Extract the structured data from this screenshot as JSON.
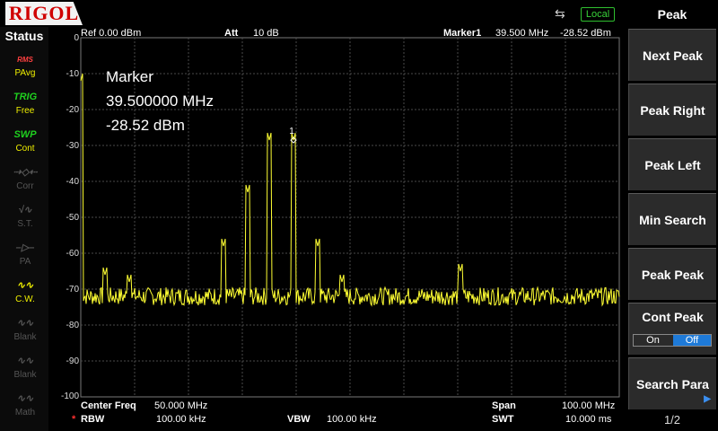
{
  "brand": "RIGOL",
  "topbar": {
    "local": "Local",
    "usb_icon": "usb-icon"
  },
  "status": {
    "title": "Status",
    "items": [
      {
        "top": "RMS",
        "label": "PAvg",
        "icon": "pavg-icon"
      },
      {
        "top": "TRIG",
        "label": "Free",
        "icon": "trig-icon"
      },
      {
        "top": "SWP",
        "label": "Cont",
        "icon": "sweep-icon"
      },
      {
        "top": "",
        "label": "Corr",
        "icon": "corr-icon"
      },
      {
        "top": "",
        "label": "S.T.",
        "icon": "st-icon"
      },
      {
        "top": "",
        "label": "PA",
        "icon": "pa-icon"
      },
      {
        "top": "",
        "label": "C.W.",
        "icon": "cw-icon"
      },
      {
        "top": "",
        "label": "Blank",
        "icon": "blank-icon"
      },
      {
        "top": "",
        "label": "Blank",
        "icon": "blank-icon"
      },
      {
        "top": "",
        "label": "Math",
        "icon": "math-icon"
      }
    ]
  },
  "header": {
    "y_top": "0",
    "ref": "Ref  0.00 dBm",
    "att_label": "Att",
    "att_value": "10 dB",
    "marker_label": "Marker1",
    "marker_freq": "39.500 MHz",
    "marker_level": "-28.52 dBm"
  },
  "marker_box": {
    "title": "Marker",
    "freq": "39.500000 MHz",
    "level": "-28.52 dBm",
    "number": "1"
  },
  "y_axis": [
    "0",
    "-10",
    "-20",
    "-30",
    "-40",
    "-50",
    "-60",
    "-70",
    "-80",
    "-90",
    "-100"
  ],
  "bottom": {
    "center_label": "Center Freq",
    "center_value": "50.000 MHz",
    "span_label": "Span",
    "span_value": "100.00 MHz",
    "rbw_star": "*",
    "rbw_label": "RBW",
    "rbw_value": "100.00 kHz",
    "vbw_label": "VBW",
    "vbw_value": "100.00 kHz",
    "swt_label": "SWT",
    "swt_value": "10.000 ms"
  },
  "menu": {
    "title": "Peak",
    "buttons": [
      "Next Peak",
      "Peak Right",
      "Peak Left",
      "Min Search",
      "Peak Peak",
      "Cont Peak",
      "Search Para"
    ],
    "cont_on": "On",
    "cont_off": "Off",
    "page": "1/2"
  },
  "colors": {
    "trace": "#ffff33",
    "grid": "#4a4a4a",
    "brand": "#d00000",
    "active_toggle": "#1e7ad8",
    "local": "#39d339"
  },
  "chart_data": {
    "type": "line",
    "x_unit": "MHz",
    "y_unit": "dBm",
    "xlim": [
      0,
      100
    ],
    "ylim": [
      -100,
      0
    ],
    "noise_floor": -72,
    "peaks": [
      {
        "x": 0.0,
        "y": -12
      },
      {
        "x": 4.5,
        "y": -66
      },
      {
        "x": 9.0,
        "y": -68
      },
      {
        "x": 26.5,
        "y": -58
      },
      {
        "x": 31.0,
        "y": -43
      },
      {
        "x": 35.0,
        "y": -28.5
      },
      {
        "x": 39.5,
        "y": -28.52
      },
      {
        "x": 44.0,
        "y": -58
      },
      {
        "x": 48.5,
        "y": -68
      },
      {
        "x": 70.5,
        "y": -65
      }
    ]
  }
}
